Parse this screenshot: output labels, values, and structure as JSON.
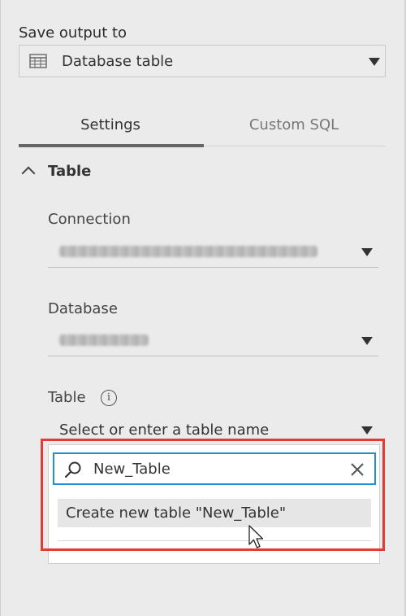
{
  "output": {
    "label": "Save output to",
    "type_value": "Database table",
    "type_icon": "table-icon"
  },
  "tabs": [
    {
      "label": "Settings",
      "active": true
    },
    {
      "label": "Custom SQL",
      "active": false
    }
  ],
  "section": {
    "title": "Table",
    "expanded": true
  },
  "connection": {
    "label": "Connection",
    "value_blurred": true
  },
  "database": {
    "label": "Database",
    "value_blurred": true
  },
  "table": {
    "label": "Table",
    "info_icon": "info-icon",
    "placeholder": "Select or enter a table name",
    "search_value": "New_Table",
    "create_option": "Create new table \"New_Table\""
  },
  "colors": {
    "accent_focus": "#1f8fd6",
    "highlight": "#e53935",
    "panel_bg": "#ebebeb"
  }
}
